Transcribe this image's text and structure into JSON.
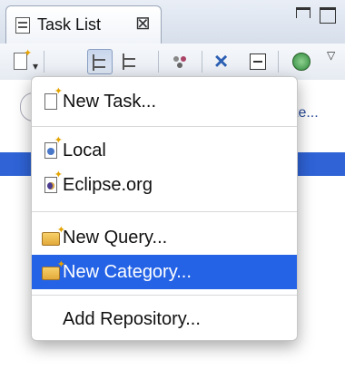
{
  "view": {
    "tab_title": "Task List",
    "close_glyph": "⊠"
  },
  "filter": {
    "link_text": "te..."
  },
  "menu": {
    "items": [
      {
        "label": "New Task...",
        "icon": "new-task-icon"
      },
      {
        "label": "Local",
        "icon": "local-repository-icon"
      },
      {
        "label": "Eclipse.org",
        "icon": "eclipse-repository-icon"
      },
      {
        "label": "New Query...",
        "icon": "new-query-icon"
      },
      {
        "label": "New Category...",
        "icon": "new-category-icon",
        "highlighted": true
      },
      {
        "label": "Add Repository...",
        "icon": ""
      }
    ]
  },
  "colors": {
    "highlight": "#2563e6",
    "selection": "#2f63d6"
  }
}
